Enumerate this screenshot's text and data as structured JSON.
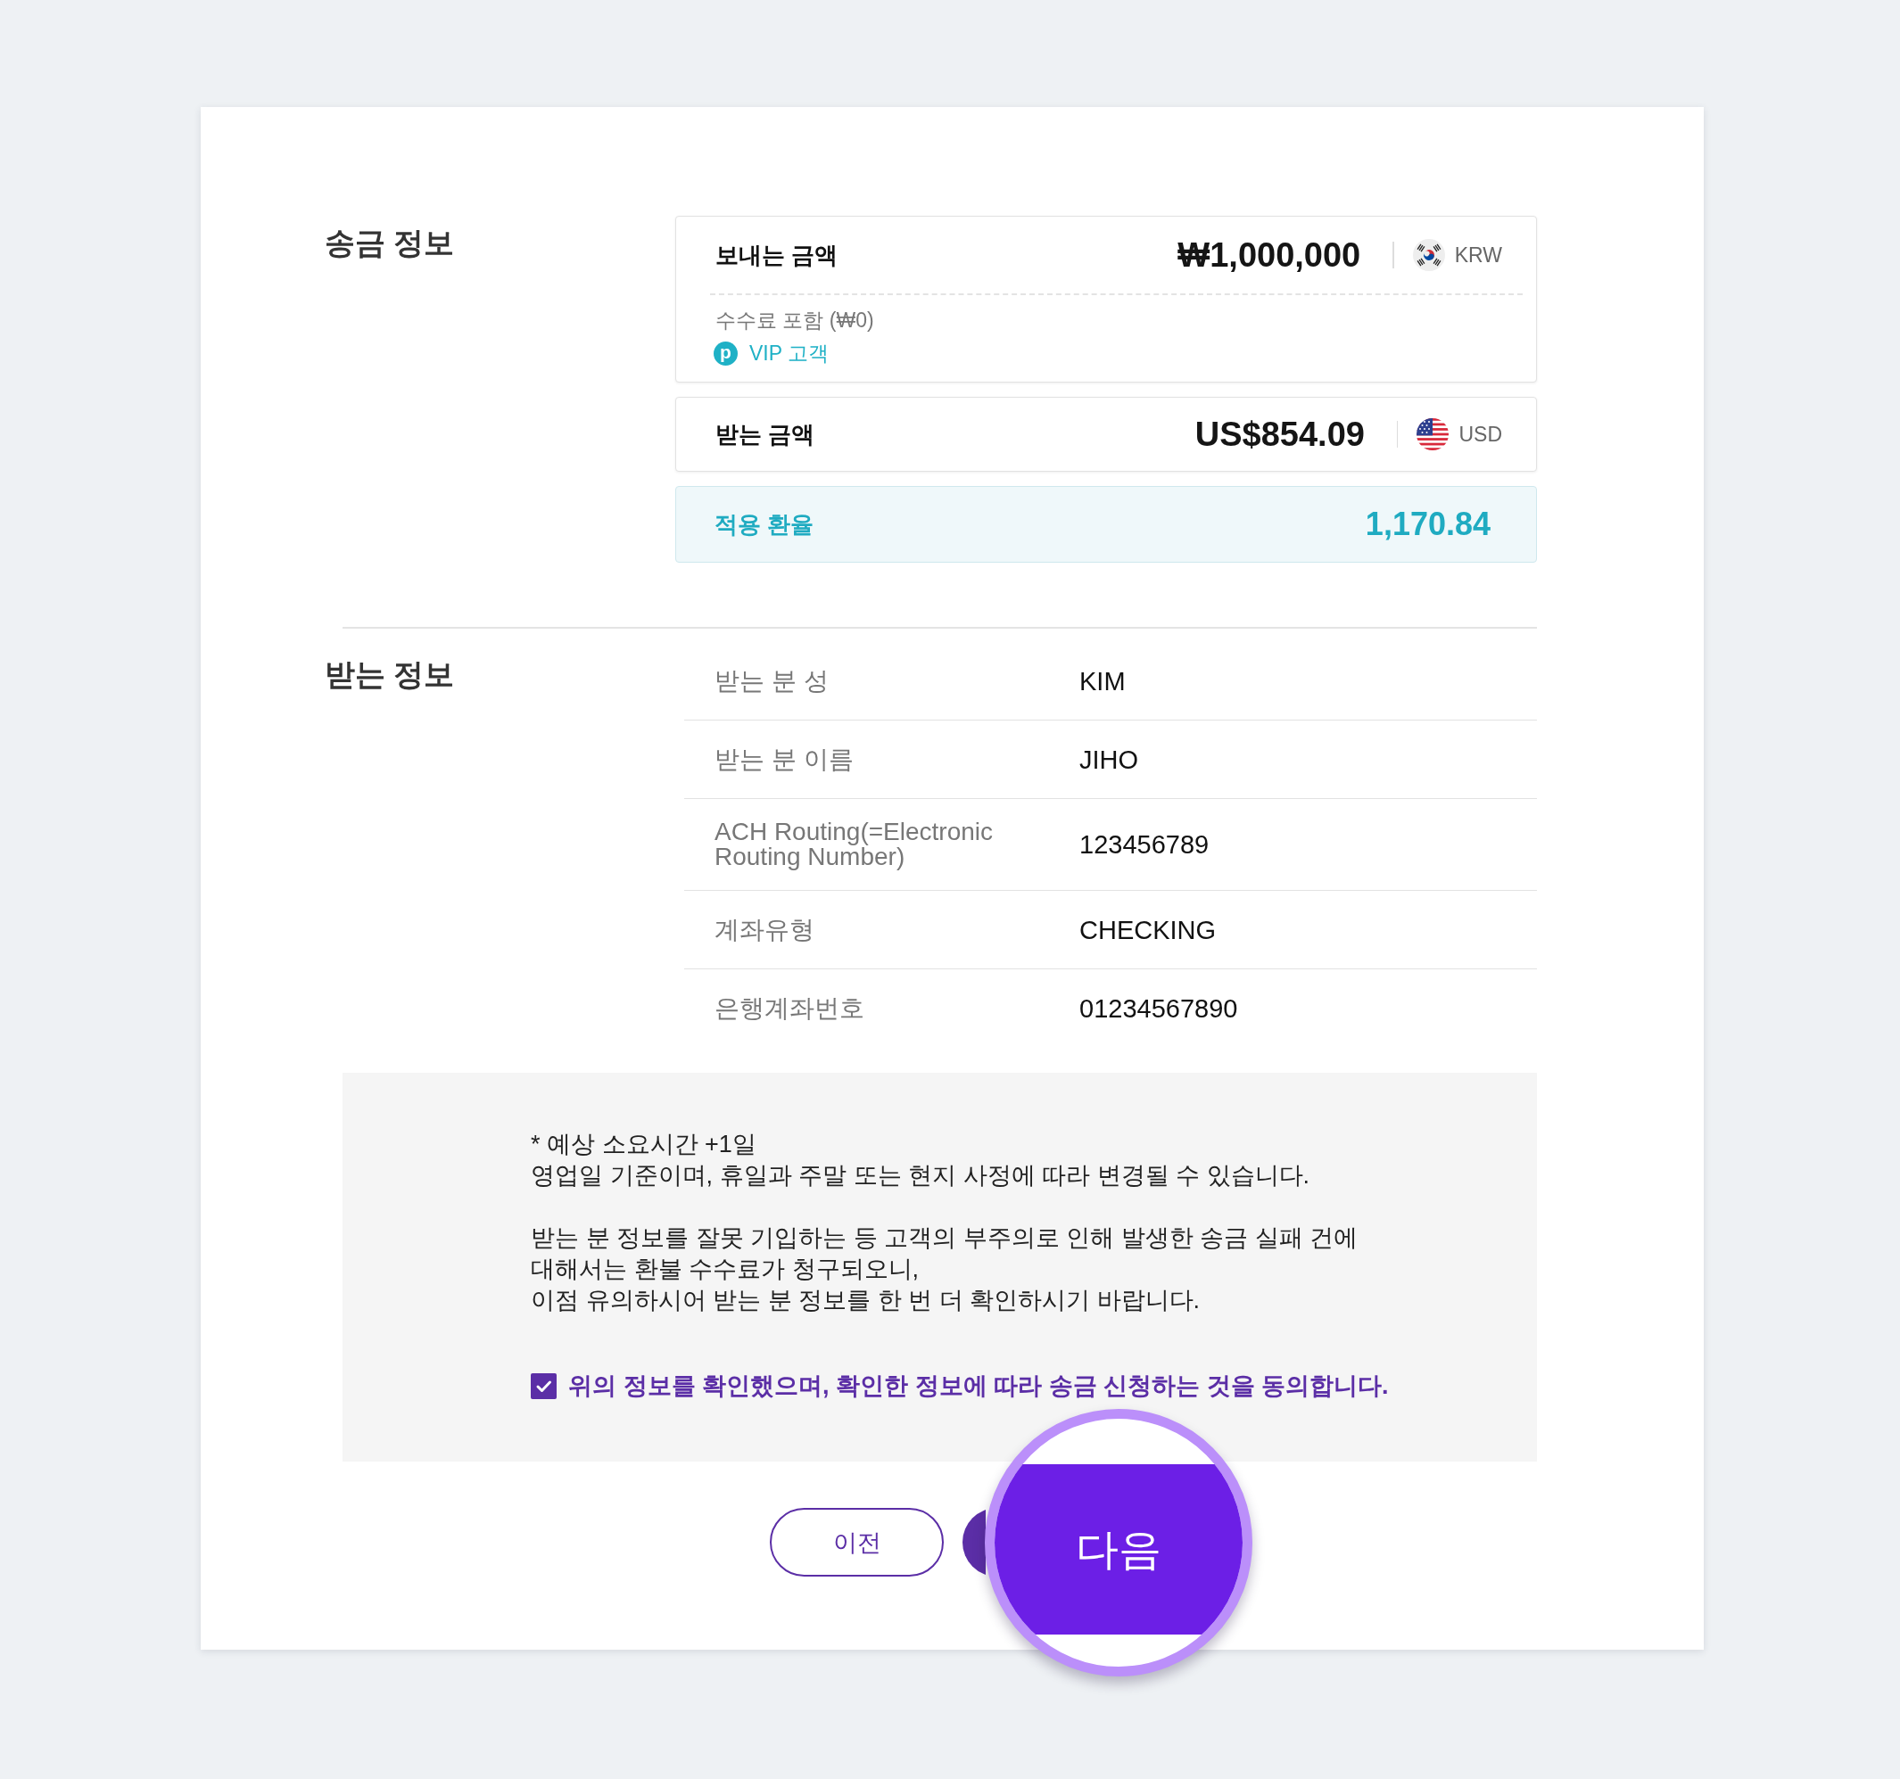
{
  "remittance": {
    "title": "송금 정보",
    "amount_cards": [
      {
        "label": "보내는 금액",
        "amount": "₩1,000,000",
        "flag": {
          "kind": "kr"
        },
        "currency": "KRW",
        "fee_note": "수수료 포함 (₩0)",
        "tier": {
          "letter": "p",
          "label": "VIP 고객"
        }
      },
      {
        "label": "받는 금액",
        "amount": "US$854.09",
        "flag": {
          "kind": "us"
        },
        "currency": "USD"
      }
    ],
    "rate": {
      "label": "적용 환율",
      "value": "1,170.84"
    }
  },
  "recipient": {
    "title": "받는 정보",
    "rows": [
      {
        "label": "받는 분 성",
        "value": "KIM"
      },
      {
        "label": "받는 분 이름",
        "value": "JIHO"
      },
      {
        "label": "ACH Routing(=Electronic Routing Number)",
        "value": "123456789"
      },
      {
        "label": "계좌유형",
        "value": "CHECKING"
      },
      {
        "label": "은행계좌번호",
        "value": "01234567890"
      }
    ]
  },
  "notice": {
    "paragraphs": [
      "* 예상 소요시간 +1일\n영업일 기준이며, 휴일과 주말 또는 현지 사정에 따라 변경될 수 있습니다.",
      "받는 분 정보를 잘못 기입하는 등 고객의 부주의로 인해 발생한 송금 실패 건에\n대해서는 환불 수수료가 청구되오니,\n이점 유의하시어 받는 분 정보를 한 번 더 확인하시기 바랍니다."
    ],
    "agreement": {
      "checked": true,
      "text": "위의 정보를 확인했으며, 확인한 정보에 따라 송금 신청하는 것을 동의합니다."
    }
  },
  "buttons": [
    {
      "kind": "outline",
      "label": "이전"
    },
    {
      "kind": "magnified",
      "label": "다음"
    }
  ]
}
